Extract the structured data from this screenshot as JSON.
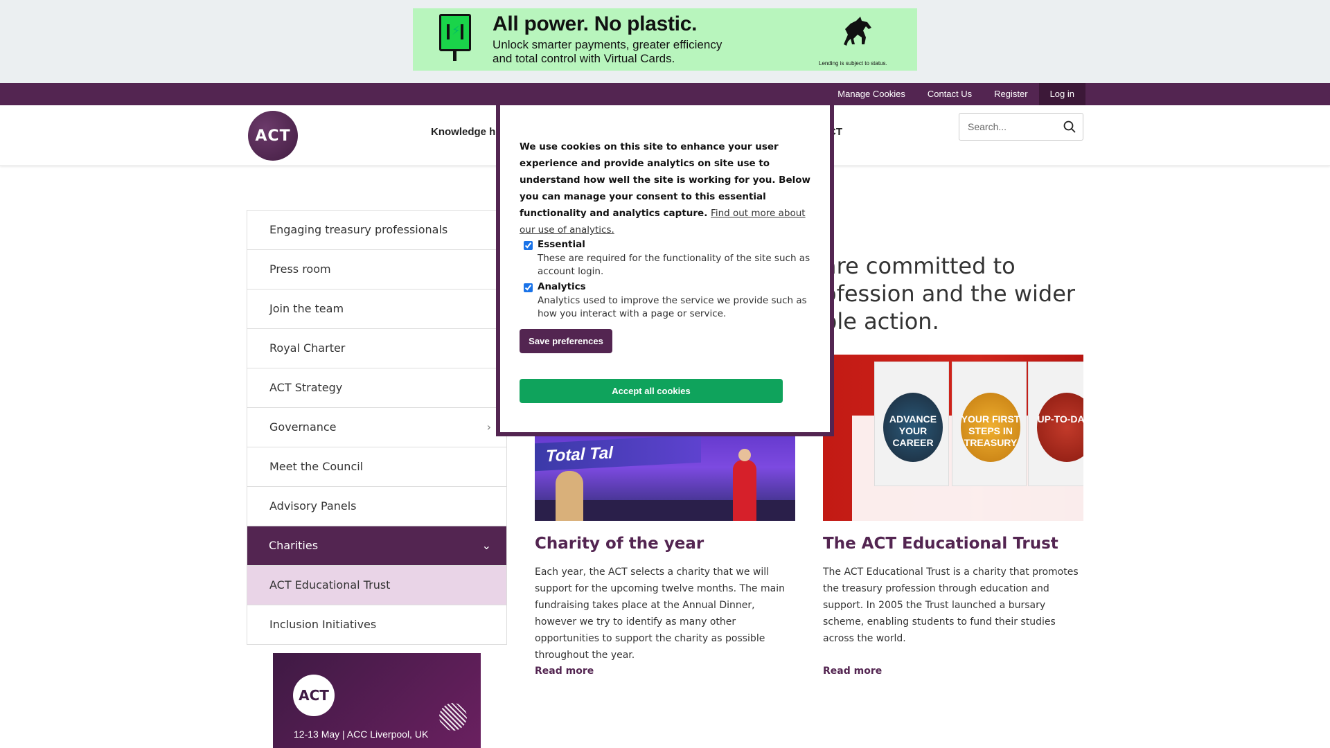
{
  "ad": {
    "title": "All power. No plastic.",
    "subtitle_line1": "Unlock smarter payments, greater efficiency",
    "subtitle_line2": "and total control with Virtual Cards.",
    "fine_print": "Lending is subject to status.",
    "background_color": "#b8f5bd"
  },
  "utility_nav": {
    "items": [
      {
        "label": "Manage Cookies"
      },
      {
        "label": "Contact Us"
      },
      {
        "label": "Register"
      },
      {
        "label": "Log in"
      }
    ]
  },
  "header": {
    "logo_text": "ACT",
    "nav_visible_first": "Knowledge h",
    "nav_visible_last": "CT",
    "search_placeholder": "Search..."
  },
  "sidebar": {
    "items": [
      {
        "label": "Engaging treasury professionals"
      },
      {
        "label": "Press room"
      },
      {
        "label": "Join the team"
      },
      {
        "label": "Royal Charter"
      },
      {
        "label": "ACT Strategy"
      },
      {
        "label": "Governance",
        "chevron": "›"
      },
      {
        "label": "Meet the Council"
      },
      {
        "label": "Advisory Panels"
      },
      {
        "label": "Charities",
        "chevron": "⌄",
        "active": true
      },
      {
        "label": "ACT Educational Trust",
        "sub": true
      },
      {
        "label": "Inclusion Initiatives"
      }
    ]
  },
  "promo": {
    "logo_text": "ACT",
    "text": "12-13 May | ACC Liverpool, UK"
  },
  "intro": {
    "line1": "are committed to",
    "line2": "ofession and the wider",
    "line3": "ble action."
  },
  "cards": [
    {
      "image_banner": "Total Tal",
      "title": "Charity of the year",
      "text": "Each year, the ACT selects a charity that we will support for the upcoming twelve months. The main fundraising takes place at the Annual Dinner, however we try to identify as many other opportunities to support the charity as possible throughout the year.",
      "link": "Read more"
    },
    {
      "image_book1": "ADVANCE YOUR CAREER",
      "image_book2": "YOUR FIRST STEPS IN TREASURY",
      "image_book3": "UP-TO-DATE",
      "title": "The ACT Educational Trust",
      "text": "The ACT Educational Trust is a charity that promotes the treasury profession through education and support. In 2005 the Trust launched a bursary scheme, enabling students to fund their studies across the world.",
      "link": "Read more"
    }
  ],
  "cookie": {
    "text": "We use cookies on this site to enhance your user experience and provide analytics on site use to understand how well the site is working for you. Below you can manage your consent to this essential functionality and analytics capture.",
    "link": "Find out more about our use of analytics.",
    "options": [
      {
        "title": "Essential",
        "desc": "These are required for the functionality of the site such as account login."
      },
      {
        "title": "Analytics",
        "desc": "Analytics used to improve the service we provide such as how you interact with a page or service."
      }
    ],
    "save_label": "Save preferences",
    "accept_label": "Accept all cookies"
  },
  "colors": {
    "brand_purple": "#532551",
    "accept_green": "#0fa35c",
    "active_sub_bg": "#e9d4e7"
  }
}
